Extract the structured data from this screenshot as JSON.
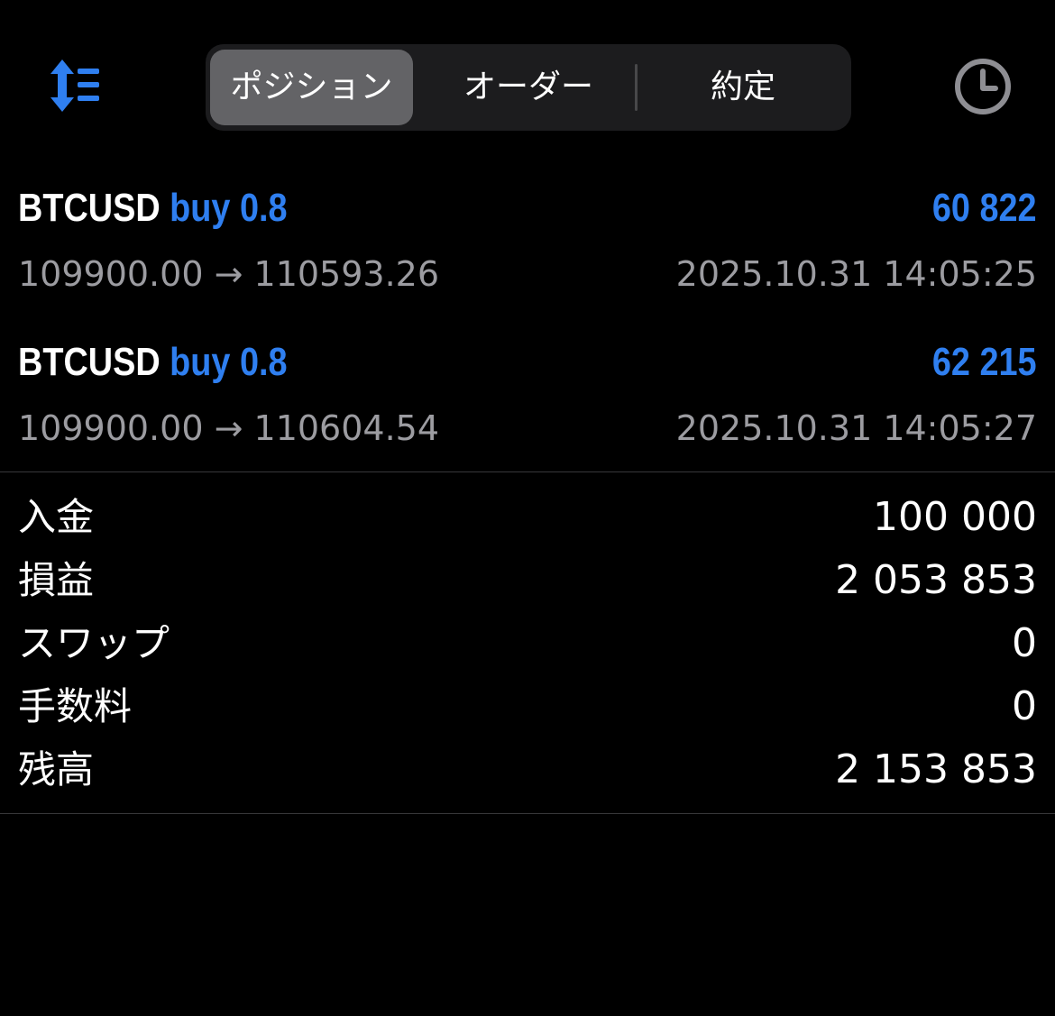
{
  "header": {
    "sort_icon": "sort-icon",
    "history_icon": "clock-icon",
    "tabs": [
      {
        "label": "ポジション",
        "active": true
      },
      {
        "label": "オーダー",
        "active": false
      },
      {
        "label": "約定",
        "active": false
      }
    ]
  },
  "positions": [
    {
      "symbol": "BTCUSD",
      "side": "buy 0.8",
      "profit": "60 822",
      "open_price": "109900.00",
      "arrow": "→",
      "current_price": "110593.26",
      "time": "2025.10.31 14:05:25"
    },
    {
      "symbol": "BTCUSD",
      "side": "buy 0.8",
      "profit": "62 215",
      "open_price": "109900.00",
      "arrow": "→",
      "current_price": "110604.54",
      "time": "2025.10.31 14:05:27"
    }
  ],
  "summary": [
    {
      "label": "入金",
      "value": "100 000"
    },
    {
      "label": "損益",
      "value": "2 053 853"
    },
    {
      "label": "スワップ",
      "value": "0"
    },
    {
      "label": "手数料",
      "value": "0"
    },
    {
      "label": "残高",
      "value": "2 153 853"
    }
  ],
  "colors": {
    "background": "#000000",
    "accent_blue": "#2f7ff0",
    "secondary_text": "#9c9ca1",
    "segment_bg": "#1c1c1e",
    "segment_active": "#636366",
    "clock_icon": "#8e8e93"
  }
}
